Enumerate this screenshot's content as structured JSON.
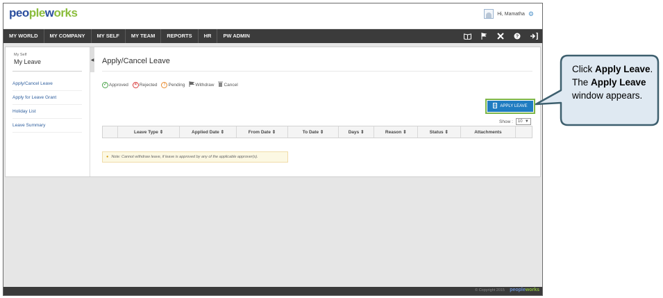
{
  "brand": {
    "part1": "peo",
    "part2": "ple",
    "part3": "w",
    "part4": "orks"
  },
  "user": {
    "greeting": "Hi, Mamatha"
  },
  "nav": {
    "items": [
      "MY WORLD",
      "MY COMPANY",
      "MY SELF",
      "MY TEAM",
      "REPORTS",
      "HR",
      "PW ADMIN"
    ],
    "icons": [
      "book-icon",
      "flag-icon",
      "tools-icon",
      "help-icon",
      "logout-icon"
    ]
  },
  "sidebar": {
    "section_small": "My Self",
    "section_title": "My Leave",
    "items": [
      "Apply/Cancel Leave",
      "Apply for Leave Grant",
      "Holiday List",
      "Leave Summary"
    ]
  },
  "main": {
    "title": "Apply/Cancel Leave",
    "legend": [
      "Approved",
      "Rejected",
      "Pending",
      "Withdraw",
      "Cancel"
    ],
    "apply_button": "APPLY LEAVE",
    "show_label": "Show :",
    "show_value": "10",
    "columns": [
      "Leave Type",
      "Applied Date",
      "From Date",
      "To Date",
      "Days",
      "Reason",
      "Status",
      "Attachments"
    ],
    "note": "Note: Cannot withdraw leave, if leave is approved by any of the applicable approver(s)."
  },
  "footer": {
    "copyright": "© Copyright 2015",
    "logo_part1": "people",
    "logo_part2": "works"
  },
  "callout": {
    "t1": "Click ",
    "t2": "Apply Leave",
    "t3": ". The ",
    "t4": "Apply Leave",
    "t5": " window appears."
  },
  "colors": {
    "accent": "#1f7cc1",
    "highlight": "#7db648",
    "callout_border": "#3d5f6e",
    "callout_fill": "#dfe9f2"
  }
}
